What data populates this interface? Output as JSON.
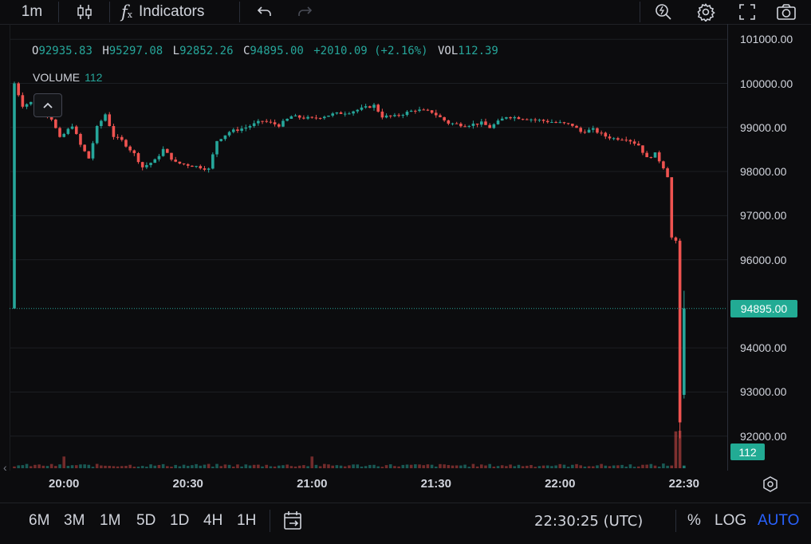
{
  "toolbar": {
    "interval": "1m",
    "indicators_label": "Indicators"
  },
  "legend": {
    "o_label": "O",
    "o_value": "92935.83",
    "h_label": "H",
    "h_value": "95297.08",
    "l_label": "L",
    "l_value": "92852.26",
    "c_label": "C",
    "c_value": "94895.00",
    "change": "+2010.09 (+2.16%)",
    "vol_label": "VOL",
    "vol_value": "112.39"
  },
  "volume_legend": {
    "title": "VOLUME",
    "value": "112"
  },
  "price_axis": {
    "ticks": [
      "101000.00",
      "100000.00",
      "99000.00",
      "98000.00",
      "97000.00",
      "96000.00",
      "94000.00",
      "93000.00",
      "92000.00"
    ],
    "last_price_label": "94895.00",
    "last_volume_label": "112"
  },
  "time_axis": {
    "ticks": [
      "20:00",
      "20:30",
      "21:00",
      "21:30",
      "22:00",
      "22:30"
    ]
  },
  "bottom": {
    "ranges": [
      "6M",
      "3M",
      "1M",
      "5D",
      "1D",
      "4H",
      "1H"
    ],
    "clock": "22:30:25 (UTC)",
    "percent": "%",
    "log": "LOG",
    "auto": "AUTO"
  },
  "colors": {
    "up": "#26a69a",
    "down": "#ef5350",
    "accent": "#2962ff",
    "background": "#0c0c0e"
  },
  "chart_data": {
    "type": "candlestick",
    "interval": "1m",
    "x_range": [
      "19:48",
      "22:31"
    ],
    "y_range": [
      91300,
      101300
    ],
    "keypoints": [
      [
        "19:48",
        100000
      ],
      [
        "19:50",
        99500
      ],
      [
        "19:53",
        99600
      ],
      [
        "19:57",
        99200
      ],
      [
        "19:59",
        98750
      ],
      [
        "20:02",
        99050
      ],
      [
        "20:04",
        98600
      ],
      [
        "20:06",
        98300
      ],
      [
        "20:08",
        99000
      ],
      [
        "20:10",
        99300
      ],
      [
        "20:12",
        98800
      ],
      [
        "20:14",
        98700
      ],
      [
        "20:17",
        98400
      ],
      [
        "20:19",
        98100
      ],
      [
        "20:22",
        98250
      ],
      [
        "20:24",
        98500
      ],
      [
        "20:27",
        98200
      ],
      [
        "20:30",
        98150
      ],
      [
        "20:33",
        98100
      ],
      [
        "20:35",
        98050
      ],
      [
        "20:37",
        98700
      ],
      [
        "20:40",
        98900
      ],
      [
        "20:44",
        99000
      ],
      [
        "20:48",
        99150
      ],
      [
        "20:52",
        99050
      ],
      [
        "20:55",
        99250
      ],
      [
        "21:00",
        99200
      ],
      [
        "21:05",
        99300
      ],
      [
        "21:09",
        99350
      ],
      [
        "21:15",
        99500
      ],
      [
        "21:17",
        99250
      ],
      [
        "21:20",
        99250
      ],
      [
        "21:25",
        99400
      ],
      [
        "21:29",
        99350
      ],
      [
        "21:33",
        99100
      ],
      [
        "21:37",
        99050
      ],
      [
        "21:41",
        99100
      ],
      [
        "21:43",
        99000
      ],
      [
        "21:47",
        99250
      ],
      [
        "21:52",
        99200
      ],
      [
        "21:56",
        99150
      ],
      [
        "22:00",
        99100
      ],
      [
        "22:03",
        99050
      ],
      [
        "22:05",
        98900
      ],
      [
        "22:08",
        98950
      ],
      [
        "22:11",
        98800
      ],
      [
        "22:13",
        98750
      ],
      [
        "22:16",
        98750
      ],
      [
        "22:19",
        98600
      ],
      [
        "22:21",
        98300
      ],
      [
        "22:23",
        98400
      ],
      [
        "22:25",
        98100
      ],
      [
        "22:26",
        97900
      ],
      [
        "22:27",
        96500
      ],
      [
        "22:28",
        96400
      ],
      [
        "22:29",
        92300
      ],
      [
        "22:30",
        94895
      ]
    ],
    "volume_peaks": [
      [
        "20:00",
        35
      ],
      [
        "21:00",
        35
      ],
      [
        "22:25",
        14
      ],
      [
        "22:28",
        110
      ],
      [
        "22:29",
        112
      ]
    ],
    "last": {
      "open": 92935.83,
      "high": 95297.08,
      "low": 92852.26,
      "close": 94895.0,
      "volume": 112.39
    }
  }
}
